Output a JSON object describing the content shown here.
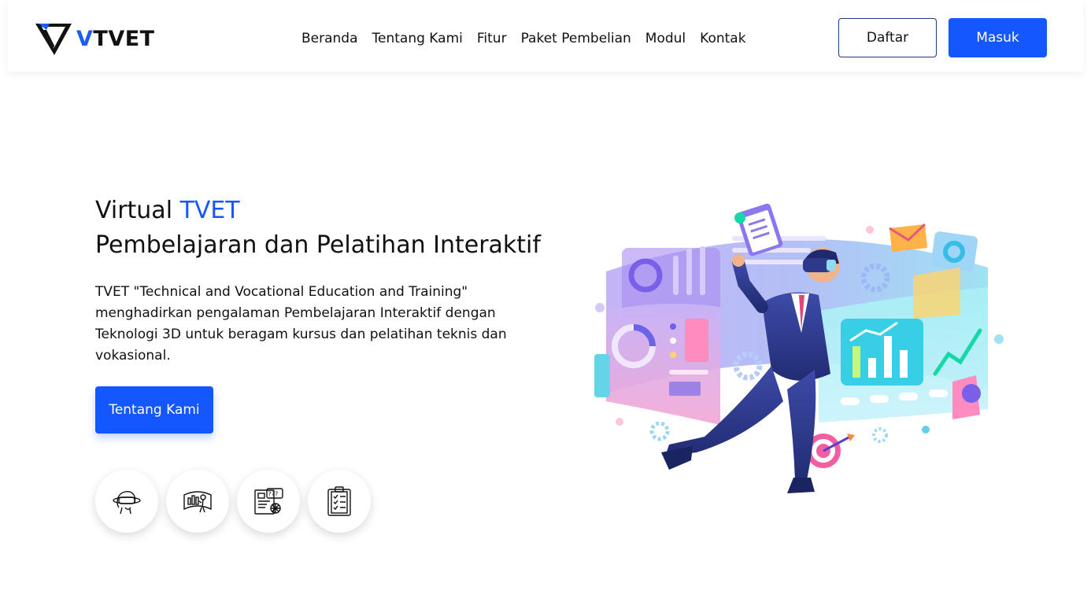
{
  "brand": {
    "name_first": "V",
    "name_rest": "TVET",
    "accent_color": "#1456ff"
  },
  "nav": {
    "items": [
      "Beranda",
      "Tentang Kami",
      "Fitur",
      "Paket Pembelian",
      "Modul",
      "Kontak"
    ],
    "register_label": "Daftar",
    "login_label": "Masuk"
  },
  "hero": {
    "title_prefix": "Virtual",
    "title_accent": "TVET",
    "subtitle": "Pembelajaran dan Pelatihan Interaktif",
    "description": "TVET \"Technical and Vocational Education and Training\" menghadirkan pengalaman Pembelajaran Interaktif dengan Teknologi 3D untuk beragam kursus dan pelatihan teknis dan vokasional.",
    "cta_label": "Tentang Kami"
  },
  "feature_icons": [
    "vr-headset-icon",
    "virtual-screen-icon",
    "quiz-document-icon",
    "checklist-clipboard-icon"
  ]
}
